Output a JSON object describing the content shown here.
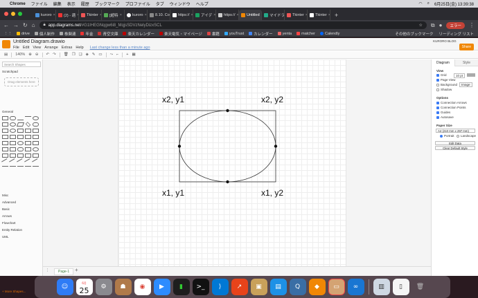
{
  "menubar": {
    "apple": "",
    "items": [
      "Chrome",
      "ファイル",
      "編集",
      "表示",
      "履歴",
      "ブックマーク",
      "プロファイル",
      "タブ",
      "ウィンドウ",
      "ヘルプ"
    ],
    "clock": "6月25日(金)  13:39:38"
  },
  "tabs": [
    {
      "label": "kuroro",
      "color": "#4a90d9"
    },
    {
      "label": "(2) - 適",
      "color": "#e33"
    },
    {
      "label": "Tkinter",
      "color": "#e55"
    },
    {
      "label": "[超特",
      "color": "#5a5"
    },
    {
      "label": "kuroro",
      "color": "#fff"
    },
    {
      "label": "8.10. Co",
      "color": "#888"
    },
    {
      "label": "https://",
      "color": "#fff"
    },
    {
      "label": "アイデ",
      "color": "#1a73e8"
    },
    {
      "label": "https://",
      "color": "#ccc"
    },
    {
      "label": "Untitled",
      "color": "#f08705"
    },
    {
      "label": "マイドラ",
      "color": "#2a8"
    },
    {
      "label": "Tkinter",
      "color": "#e55"
    },
    {
      "label": "Tkinter",
      "color": "#fff"
    }
  ],
  "address": {
    "host": "app.diagrams.net",
    "path": "/#G1IHEGNqgw6i8_MqjsSDVzNelyDizxSCL",
    "error_label": "エラー"
  },
  "bookmarks": [
    "drive",
    "個人制作",
    "株関連",
    "年金",
    "青空文庫",
    "楽天カレンダー",
    "楽天電気・マイページ",
    "書籍",
    "youTrust",
    "カレンダー",
    "yenta",
    "matcher",
    "Calendly"
  ],
  "bookmarks_right": [
    "その他のブックマーク",
    "リーディング リスト"
  ],
  "app": {
    "title": "Untitled Diagram.drawio",
    "menus": [
      "File",
      "Edit",
      "View",
      "Arrange",
      "Extras",
      "Help"
    ],
    "saved_text": "Last change less than a minute ago",
    "user": "KURORO BLOG",
    "share_label": "Share",
    "zoom": "140%",
    "search_placeholder": "Search Shapes",
    "scratchpad": "Scratchpad",
    "drag_hint": "Drag elements here",
    "general": "General",
    "categories": [
      "Misc",
      "Advanced",
      "Basic",
      "Arrows",
      "Flowchart",
      "Entity Relation",
      "UML"
    ],
    "more_shapes": "+ More Shapes...",
    "page_tab": "Page-1"
  },
  "canvas_labels": {
    "top_left": "x2, y1",
    "top_right": "x2, y2",
    "bottom_left": "x1, y1",
    "bottom_right": "x1, y2"
  },
  "format_panel": {
    "tabs": [
      "Diagram",
      "Style"
    ],
    "view": "View",
    "grid": "Grid",
    "grid_size": "10 pt",
    "page_view": "Page View",
    "background": "Background",
    "image_btn": "Image",
    "shadow": "Shadow",
    "options": "Options",
    "connection_arrows": "Connection Arrows",
    "connection_points": "Connection Points",
    "guides": "Guides",
    "autosave": "Autosave",
    "paper_size": "Paper Size",
    "paper_value": "A4 (210 mm x 297 mm)",
    "portrait": "Portrait",
    "landscape": "Landscape",
    "edit_data": "Edit Data",
    "clear_style": "Clear Default Style"
  },
  "dock": {
    "calendar_month": "6月",
    "calendar_day": "25"
  }
}
